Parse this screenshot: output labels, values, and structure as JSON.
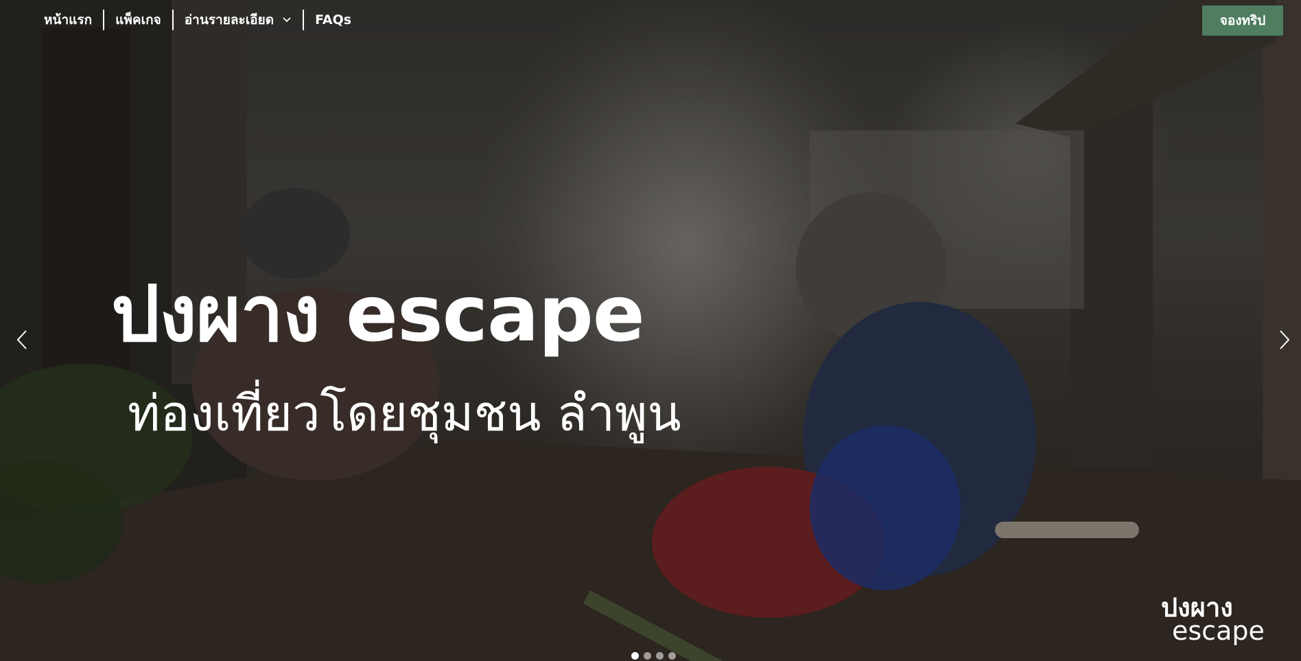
{
  "nav": {
    "items": [
      {
        "label": "หน้าแรก"
      },
      {
        "label": "แพ็คเกจ"
      },
      {
        "label": "อ่านรายละเอียด"
      },
      {
        "label": "FAQs"
      }
    ]
  },
  "book_button": {
    "label": "จองทริป"
  },
  "hero": {
    "title": "ปงผาง escape",
    "subtitle": "ท่องเที่ยวโดยชุมชน ลำพูน"
  },
  "logo": {
    "line1": "ปงผาง",
    "line2": "escape"
  },
  "carousel": {
    "slide_count": 4,
    "active_slide": 1
  },
  "icons": {
    "prev": "chevron-left-icon",
    "next": "chevron-right-icon",
    "dropdown": "chevron-down-icon"
  },
  "colors": {
    "accent": "#4f7d60",
    "text": "#ffffff"
  }
}
